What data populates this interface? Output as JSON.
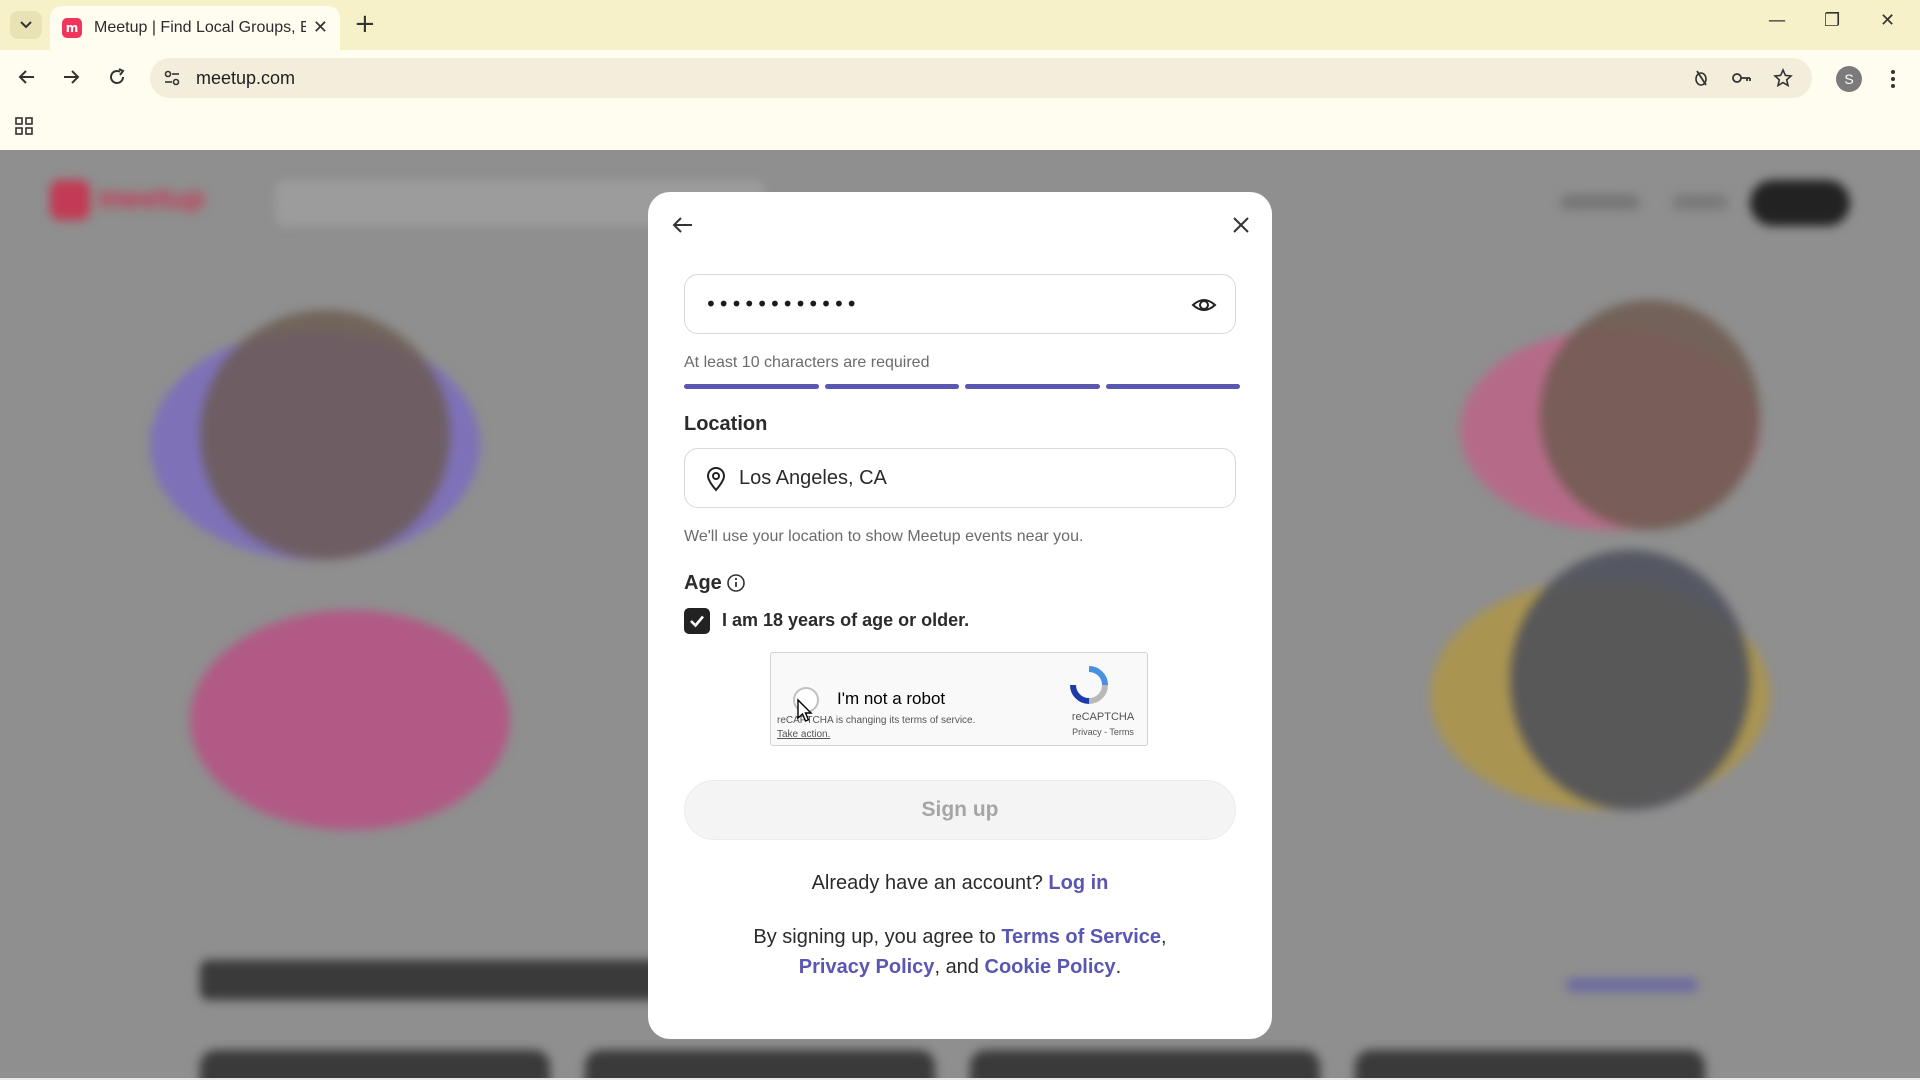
{
  "browser": {
    "tab_title": "Meetup | Find Local Groups, Events",
    "favicon_letter": "m",
    "url": "meetup.com",
    "avatar_letter": "S"
  },
  "background_page": {
    "logo_text": "meetup"
  },
  "modal": {
    "password_value": "••••••••••••",
    "password_hint": "At least 10 characters are required",
    "password_strength_segments_filled": 4,
    "location_label": "Location",
    "location_value": "Los Angeles, CA",
    "location_help": "We'll use your location to show Meetup events near you.",
    "age_label": "Age",
    "age_checkbox_label": "I am 18 years of age or older.",
    "age_checked": true,
    "captcha": {
      "label": "I'm not a robot",
      "notice": "reCAPTCHA is changing its terms of service.",
      "action": "Take action.",
      "brand": "reCAPTCHA",
      "links": "Privacy - Terms"
    },
    "signup_button": "Sign up",
    "have_account_text": "Already have an account?",
    "login_link": "Log in",
    "legal_prefix": "By signing up, you agree to",
    "terms_link": "Terms of Service",
    "privacy_link": "Privacy Policy",
    "legal_and": "and",
    "cookie_link": "Cookie Policy"
  },
  "colors": {
    "accent": "#5a57b2",
    "brand": "#f0355d"
  }
}
